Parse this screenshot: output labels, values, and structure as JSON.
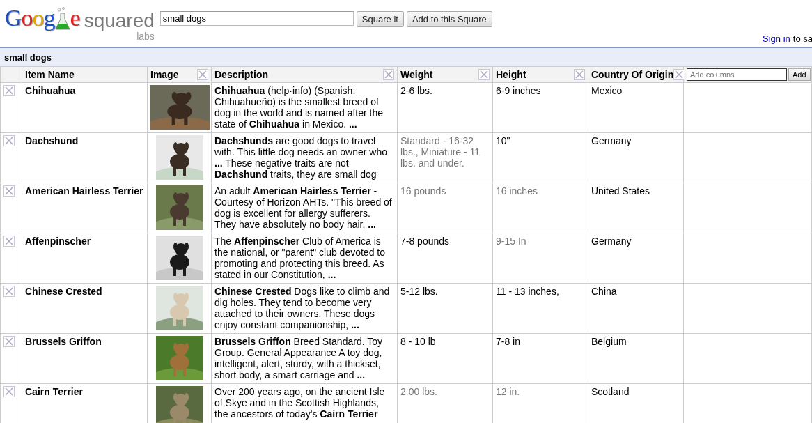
{
  "header": {
    "logo_left": "Goog",
    "logo_right": "e",
    "product": "squared",
    "badge": "labs",
    "search": {
      "value": "small dogs"
    },
    "buttons": [
      "Square it",
      "Add to this Square"
    ],
    "sign_in_link": "Sign in",
    "sign_in_rest": "to sa"
  },
  "square": {
    "title": "small dogs",
    "columns": [
      {
        "label": "Item Name",
        "removable": false
      },
      {
        "label": "Image",
        "removable": true
      },
      {
        "label": "Description",
        "removable": true
      },
      {
        "label": "Weight",
        "removable": true
      },
      {
        "label": "Height",
        "removable": true
      },
      {
        "label": "Country Of Origin",
        "removable": true
      }
    ],
    "add_columns": {
      "placeholder": "Add columns",
      "button": "Add"
    },
    "rows": [
      {
        "name": "Chihuahua",
        "description": "**Chihuahua** (help·info) (Spanish: Chihuahueño) is the smallest breed of dog in the world and is named after the state of **Chihuahua** in Mexico. **...**",
        "weight": {
          "text": "2-6 lbs.",
          "muted": false
        },
        "height": {
          "text": "6-9 inches",
          "muted": false
        },
        "country": {
          "text": "Mexico",
          "muted": false
        }
      },
      {
        "name": "Dachshund",
        "description": "**Dachshunds** are good dogs to travel with. This little dog needs an owner who **...** These negative traits are not **Dachshund** traits, they are small dog",
        "weight": {
          "text": "Standard - 16-32 lbs., Miniature - 11 lbs. and under.",
          "muted": true
        },
        "height": {
          "text": "10\"",
          "muted": false
        },
        "country": {
          "text": "Germany",
          "muted": false
        }
      },
      {
        "name": "American Hairless Terrier",
        "description": "An adult **American Hairless Terrier** - Courtesy of Horizon AHTs. \"This breed of dog is excellent for allergy sufferers. They have absolutely no body hair, **...**",
        "weight": {
          "text": "16 pounds",
          "muted": true
        },
        "height": {
          "text": "16 inches",
          "muted": true
        },
        "country": {
          "text": "United States",
          "muted": false
        }
      },
      {
        "name": "Affenpinscher",
        "description": "The **Affenpinscher** Club of America is the national, or \"parent\" club devoted to promoting and protecting this breed. As stated in our Constitution, **...**",
        "weight": {
          "text": "7-8 pounds",
          "muted": false
        },
        "height": {
          "text": "9-15 In",
          "muted": true
        },
        "country": {
          "text": "Germany",
          "muted": false
        }
      },
      {
        "name": "Chinese Crested",
        "description": "**Chinese Crested** Dogs like to climb and dig holes. They tend to become very attached to their owners. These dogs enjoy constant companionship, **...**",
        "weight": {
          "text": "5-12 lbs.",
          "muted": false
        },
        "height": {
          "text": "11 - 13 inches,",
          "muted": false
        },
        "country": {
          "text": "China",
          "muted": false
        }
      },
      {
        "name": "Brussels Griffon",
        "description": "**Brussels Griffon** Breed Standard. Toy Group. General Appearance A toy dog, intelligent, alert, sturdy, with a thickset, short body, a smart carriage and **...**",
        "weight": {
          "text": "8 - 10 lb",
          "muted": false
        },
        "height": {
          "text": "7-8 in",
          "muted": false
        },
        "country": {
          "text": "Belgium",
          "muted": false
        }
      },
      {
        "name": "Cairn Terrier",
        "description": "Over 200 years ago, on the ancient Isle of Skye and in the Scottish Highlands, the ancestors of today's **Cairn Terrier**",
        "weight": {
          "text": "2.00 lbs.",
          "muted": true
        },
        "height": {
          "text": "12 in.",
          "muted": true
        },
        "country": {
          "text": "Scotland",
          "muted": false
        }
      }
    ]
  }
}
